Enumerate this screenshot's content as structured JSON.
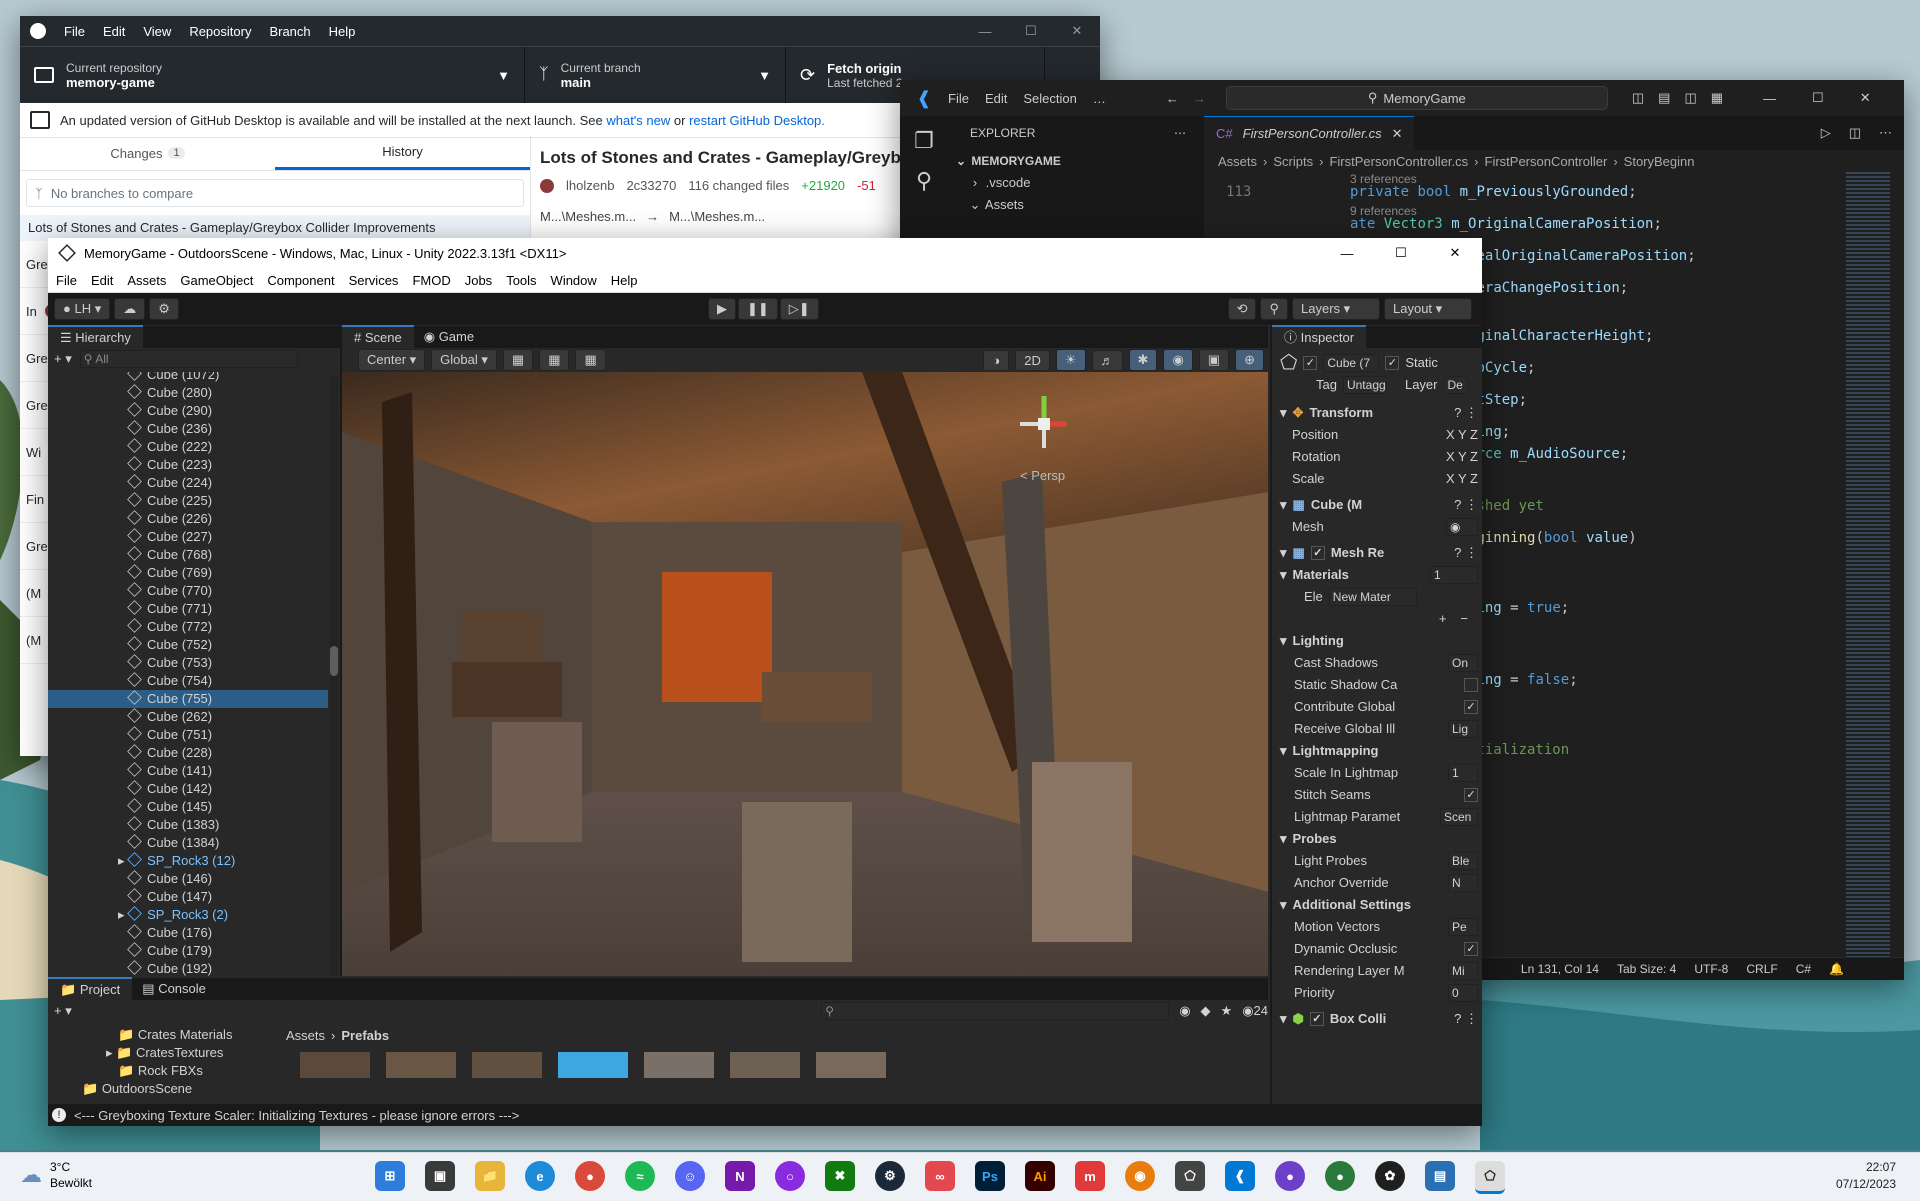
{
  "github": {
    "menu": [
      "File",
      "Edit",
      "View",
      "Repository",
      "Branch",
      "Help"
    ],
    "repo_label": "Current repository",
    "repo_value": "memory-game",
    "branch_label": "Current branch",
    "branch_value": "main",
    "fetch_label": "Fetch origin",
    "fetch_sub": "Last fetched 2",
    "banner_text": "An updated version of GitHub Desktop is available and will be installed at the next launch. See",
    "banner_link1": "what's new",
    "banner_or": "or",
    "banner_link2": "restart GitHub Desktop.",
    "tab_changes": "Changes",
    "tab_changes_count": "1",
    "tab_history": "History",
    "compare_placeholder": "No branches to compare",
    "commit_title": "Lots of Stones and Crates - Gameplay/Greybox Col",
    "commit_author": "lholzenb",
    "commit_sha": "2c33270",
    "commit_files": "116 changed files",
    "commit_add": "+21920",
    "commit_del": "-51",
    "history_first": "Lots of Stones and Crates - Gameplay/Greybox Collider Improvements",
    "history_items": [
      "Gre",
      "In",
      "Gre",
      "Gre",
      "Wi",
      "Fin",
      "Gre",
      "(M",
      "(M"
    ],
    "path1": "M...\\Meshes.m...",
    "path2": "M...\\Meshes.m..."
  },
  "vscode": {
    "menu": [
      "File",
      "Edit",
      "Selection",
      "…"
    ],
    "search": "MemoryGame",
    "explorer_title": "EXPLORER",
    "workspace": "MEMORYGAME",
    "tree": [
      ".vscode",
      "Assets"
    ],
    "tab": "FirstPersonController.cs",
    "breadcrumb": [
      "Assets",
      "Scripts",
      "FirstPersonController.cs",
      "FirstPersonController",
      "StoryBeginn"
    ],
    "line_number": "113",
    "status": [
      "Ln 131, Col 14",
      "Tab Size: 4",
      "UTF-8",
      "CRLF",
      "C#"
    ],
    "refs3": "3 references",
    "refs9": "9 references",
    "refs": "erences"
  },
  "unity": {
    "title": "MemoryGame - OutdoorsScene - Windows, Mac, Linux - Unity 2022.3.13f1 <DX11>",
    "menu": [
      "File",
      "Edit",
      "Assets",
      "GameObject",
      "Component",
      "Services",
      "FMOD",
      "Jobs",
      "Tools",
      "Window",
      "Help"
    ],
    "account": "LH",
    "layers": "Layers",
    "layout": "Layout",
    "hierarchy_tab": "Hierarchy",
    "hierarchy_search": "All",
    "hierarchy_items": [
      "Cube (1072)",
      "Cube (280)",
      "Cube (290)",
      "Cube (236)",
      "Cube (222)",
      "Cube (223)",
      "Cube (224)",
      "Cube (225)",
      "Cube (226)",
      "Cube (227)",
      "Cube (768)",
      "Cube (769)",
      "Cube (770)",
      "Cube (771)",
      "Cube (772)",
      "Cube (752)",
      "Cube (753)",
      "Cube (754)",
      "Cube (755)",
      "Cube (262)",
      "Cube (751)",
      "Cube (228)",
      "Cube (141)",
      "Cube (142)",
      "Cube (145)",
      "Cube (1383)",
      "Cube (1384)",
      "SP_Rock3 (12)",
      "Cube (146)",
      "Cube (147)",
      "SP_Rock3 (2)",
      "Cube (176)",
      "Cube (179)",
      "Cube (192)"
    ],
    "scene_tab": "Scene",
    "game_tab": "Game",
    "pivot": "Center",
    "space": "Global",
    "mode2d": "2D",
    "persp": "< Persp",
    "inspector_tab": "Inspector",
    "obj_name": "Cube (7",
    "static_label": "Static",
    "tag_label": "Tag",
    "tag_value": "Untagged",
    "layer_label": "Layer",
    "layer_value": "De",
    "transform": "Transform",
    "pos": "Position",
    "rot": "Rotation",
    "scale": "Scale",
    "meshfilter": "Cube (M",
    "mesh": "Mesh",
    "meshrenderer": "Mesh Re",
    "materials": "Materials",
    "materials_count": "1",
    "element": "Ele",
    "material_value": "New Mater",
    "lighting": "Lighting",
    "cast_shadows": "Cast Shadows",
    "cast_shadows_val": "On",
    "static_shadow": "Static Shadow Ca",
    "contribute_gi": "Contribute Global",
    "receive_gi": "Receive Global Ill",
    "receive_gi_val": "Lig",
    "lightmapping": "Lightmapping",
    "scale_lightmap": "Scale In Lightmap",
    "scale_lightmap_val": "1",
    "stitch": "Stitch Seams",
    "lightmap_params": "Lightmap Paramet",
    "lightmap_params_val": "Scen",
    "probes": "Probes",
    "light_probes": "Light Probes",
    "light_probes_val": "Ble",
    "anchor": "Anchor Override",
    "anchor_val": "N",
    "additional": "Additional Settings",
    "motion": "Motion Vectors",
    "motion_val": "Pe",
    "dynamic_occ": "Dynamic Occlusic",
    "render_layer": "Rendering Layer M",
    "render_layer_val": "Mi",
    "priority": "Priority",
    "priority_val": "0",
    "box_collider": "Box Colli",
    "project_tab": "Project",
    "console_tab": "Console",
    "folders": [
      "Crates Materials",
      "CratesTextures",
      "Rock FBXs",
      "OutdoorsScene"
    ],
    "breadcrumb": [
      "Assets",
      "Prefabs"
    ],
    "hidden_count": "24",
    "console_msg": "<--- Greyboxing Texture Scaler: Initializing Textures - please ignore errors --->"
  },
  "taskbar": {
    "temp": "3°C",
    "weather": "Bewölkt",
    "time": "22:07",
    "date": "07/12/2023"
  },
  "colors": {
    "unity_selection": "#2c5d87",
    "github_dark": "#24292e",
    "vscode_accent": "#0078d4"
  }
}
